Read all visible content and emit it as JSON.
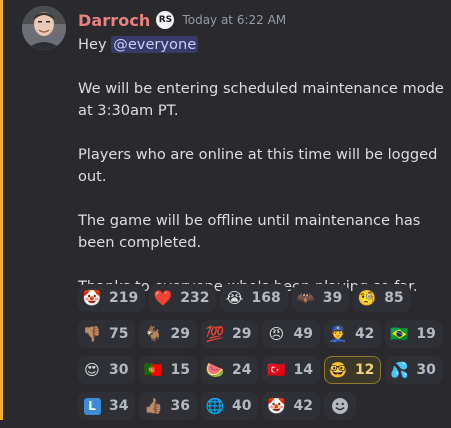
{
  "message": {
    "username": "Darroch",
    "role_badge": "RS",
    "timestamp": "Today at 6:22 AM",
    "greeting": "Hey ",
    "mention": "@everyone",
    "paragraphs": [
      "We will be entering scheduled maintenance mode at 3:30am PT.",
      "Players who are online at this time will be logged out.",
      "The game will be offline until maintenance has been completed.",
      "Thanks to everyone who's been playing so far."
    ]
  },
  "reactions": [
    {
      "icon": "clown-face",
      "glyph": "🤡",
      "count": "219"
    },
    {
      "icon": "red-heart",
      "glyph": "❤️",
      "count": "232"
    },
    {
      "icon": "loudly-crying-face",
      "glyph": "😭",
      "count": "168"
    },
    {
      "icon": "bat",
      "glyph": "🦇",
      "count": "39"
    },
    {
      "icon": "face-with-monocle",
      "glyph": "🧐",
      "count": "85"
    },
    {
      "icon": "thumbs-down",
      "glyph": "👎🏽",
      "count": "75"
    },
    {
      "icon": "goat",
      "glyph": "🐐",
      "count": "29"
    },
    {
      "icon": "hundred-points",
      "glyph": "💯",
      "count": "29"
    },
    {
      "icon": "angry-face",
      "glyph": "😠",
      "count": "49"
    },
    {
      "icon": "police-officer",
      "glyph": "👮",
      "count": "42"
    },
    {
      "icon": "flag-brazil",
      "glyph": "🇧🇷",
      "count": "19"
    },
    {
      "icon": "heart-eyes-face",
      "glyph": "😍",
      "count": "30"
    },
    {
      "icon": "flag-portugal",
      "glyph": "🇵🇹",
      "count": "15"
    },
    {
      "icon": "watermelon",
      "glyph": "🍉",
      "count": "24"
    },
    {
      "icon": "flag-turkey",
      "glyph": "🇹🇷",
      "count": "14"
    },
    {
      "icon": "nerd-face",
      "glyph": "🤓",
      "count": "12",
      "active": true
    },
    {
      "icon": "sweat-emoji",
      "glyph": "💦",
      "count": "30"
    },
    {
      "icon": "letter-l-button",
      "glyph": "L",
      "count": "34"
    },
    {
      "icon": "thumbs-up",
      "glyph": "👍🏽",
      "count": "36"
    },
    {
      "icon": "globe-emoji",
      "glyph": "🌐",
      "count": "40"
    },
    {
      "icon": "clown-heart-eyes",
      "glyph": "🤡",
      "count": "42"
    }
  ],
  "add_reaction": {
    "icon": "add-reaction-smiley"
  },
  "colors": {
    "username": "#e8837d",
    "mention_highlight": "#f0b232",
    "background": "#2a2a2e",
    "reaction_bg": "#2f3036",
    "reaction_active_border": "#8f7a35"
  }
}
